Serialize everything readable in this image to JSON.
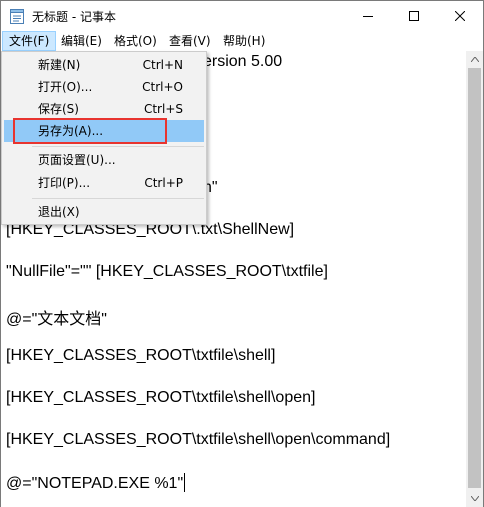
{
  "window": {
    "title": "无标题 - 记事本"
  },
  "menubar": {
    "items": [
      {
        "label": "文件(F)"
      },
      {
        "label": "编辑(E)"
      },
      {
        "label": "格式(O)"
      },
      {
        "label": "查看(V)"
      },
      {
        "label": "帮助(H)"
      }
    ]
  },
  "file_menu": {
    "items": [
      {
        "label": "新建(N)",
        "shortcut": "Ctrl+N"
      },
      {
        "label": "打开(O)...",
        "shortcut": "Ctrl+O"
      },
      {
        "label": "保存(S)",
        "shortcut": "Ctrl+S"
      },
      {
        "label": "另存为(A)...",
        "shortcut": ""
      },
      {
        "label": "页面设置(U)...",
        "shortcut": ""
      },
      {
        "label": "打印(P)...",
        "shortcut": "Ctrl+P"
      },
      {
        "label": "退出(X)",
        "shortcut": ""
      }
    ],
    "highlighted": "另存为(A)..."
  },
  "editor": {
    "visible_fragments": [
      "ersion 5.00",
      "]",
      "n\""
    ],
    "lines": [
      "[HKEY_CLASSES_ROOT\\.txt\\ShellNew]",
      "\"NullFile\"=\"\" [HKEY_CLASSES_ROOT\\txtfile]",
      "@=\"文本文档\"",
      "[HKEY_CLASSES_ROOT\\txtfile\\shell]",
      "[HKEY_CLASSES_ROOT\\txtfile\\shell\\open]",
      "[HKEY_CLASSES_ROOT\\txtfile\\shell\\open\\command]",
      "@=\"NOTEPAD.EXE %1\""
    ]
  },
  "colors": {
    "menu_hover": "#91c9f7",
    "annotation_box": "#e8342f"
  }
}
